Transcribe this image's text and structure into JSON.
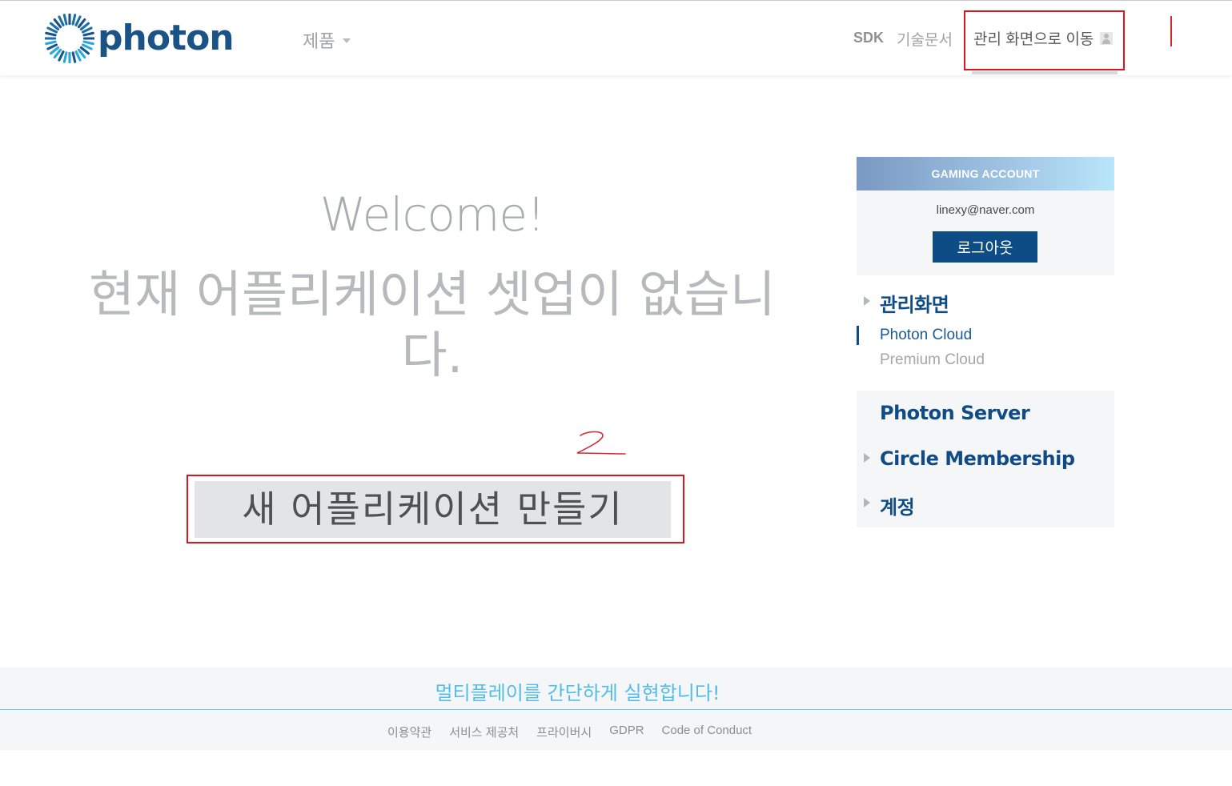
{
  "header": {
    "logo_text": "photon",
    "nav": {
      "products": "제품",
      "sdk": "SDK",
      "docs": "기술문서",
      "admin": "관리 화면으로 이동"
    }
  },
  "main": {
    "welcome": "Welcome!",
    "no_apps": "현재 어플리케이션 셋업이 없습니다.",
    "create_button": "새 어플리케이션 만들기"
  },
  "sidebar": {
    "account": {
      "header": "GAMING ACCOUNT",
      "email": "linexy@naver.com",
      "logout": "로그아웃"
    },
    "management": {
      "title": "관리화면",
      "items": [
        "Photon Cloud",
        "Premium Cloud"
      ]
    },
    "photon_server": "Photon Server",
    "circle_membership": "Circle Membership",
    "account_menu": "계정"
  },
  "footer": {
    "tagline": "멀티플레이를 간단하게 실현합니다!",
    "links": [
      "이용약관",
      "서비스 제공처",
      "프라이버시",
      "GDPR",
      "Code of Conduct"
    ]
  },
  "colors": {
    "brand": "#1c5387",
    "accent_cyan": "#52bde8",
    "annotation_red": "#e0141e"
  }
}
